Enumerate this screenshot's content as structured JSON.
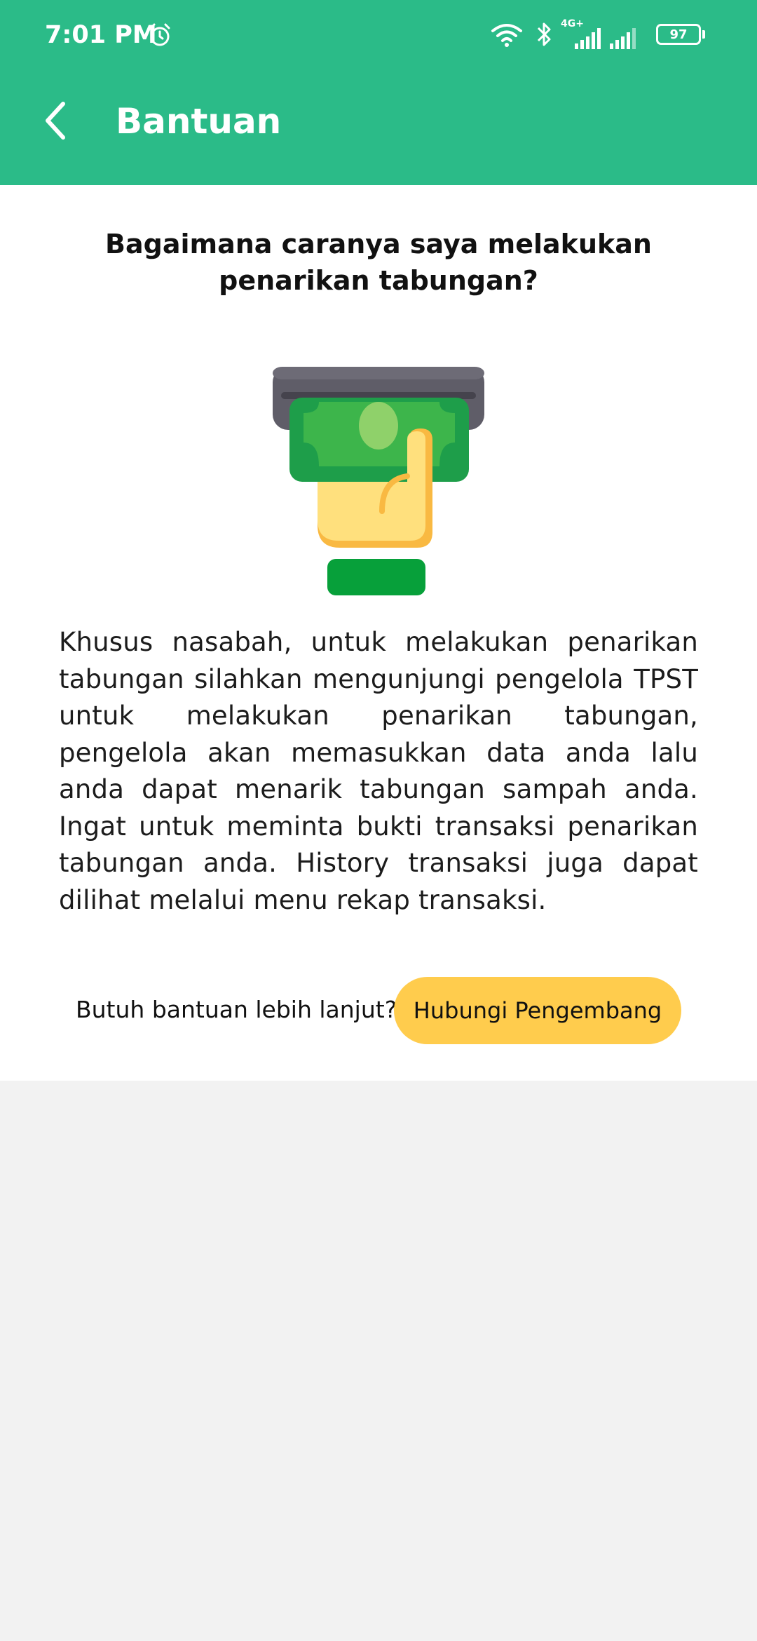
{
  "status_bar": {
    "time": "7:01 PM",
    "network": "4G+",
    "battery": "97",
    "icons": [
      "alarm-icon",
      "wifi-icon",
      "bluetooth-icon",
      "signal-icon",
      "signal-icon",
      "battery-icon"
    ]
  },
  "appbar": {
    "back_icon": "chevron-left-icon",
    "title": "Bantuan"
  },
  "faq": {
    "question": "Bagaimana caranya saya melakukan penarikan tabungan?",
    "illustration_icon": "atm-cash-withdrawal-icon",
    "answer": "Khusus nasabah, untuk melakukan penarikan tabungan silahkan mengunjungi pengelola TPST untuk melakukan penarikan tabungan, pengelola akan memasukkan data anda lalu anda dapat menarik tabungan sampah anda. Ingat untuk meminta bukti transaksi penarikan tabungan anda. History transaksi juga dapat dilihat melalui menu rekap transaksi."
  },
  "help": {
    "prompt": "Butuh bantuan lebih lanjut?",
    "button_label": "Hubungi Pengembang"
  },
  "colors": {
    "primary": "#2bbb88",
    "accent": "#ffcc4d",
    "background": "#f2f2f2"
  }
}
